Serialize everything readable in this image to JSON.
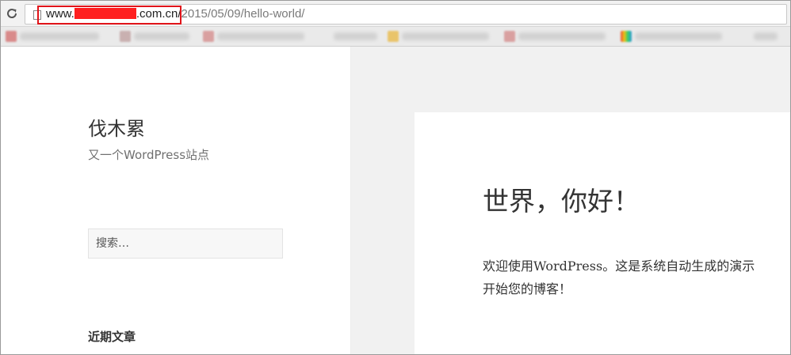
{
  "browser": {
    "url_prefix": "www.",
    "url_suffix": ".com.cn/",
    "url_path": "2015/05/09/hello-world/"
  },
  "colors": {
    "highlight": "#e0141a",
    "redaction": "#ff1f1f",
    "main_background": "#f1f1f1"
  },
  "icons": [
    "reload-icon",
    "page-icon"
  ],
  "sidebar": {
    "site_title": "伐木累",
    "site_description": "又一个WordPress站点",
    "search_placeholder": "搜索…",
    "widget_title": "近期文章"
  },
  "post": {
    "title": "世界，你好！",
    "body_line1": "欢迎使用WordPress。这是系统自动生成的演示",
    "body_line2": "开始您的博客！"
  }
}
